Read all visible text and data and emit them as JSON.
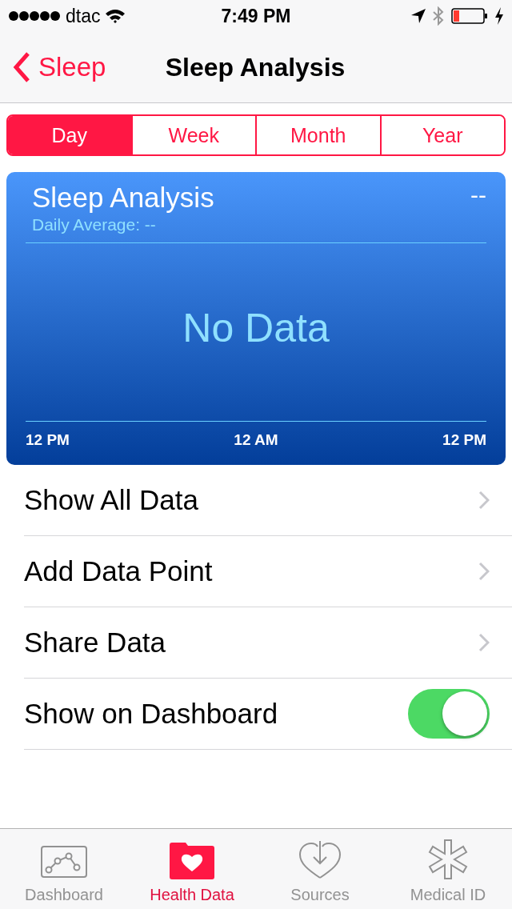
{
  "status_bar": {
    "carrier": "dtac",
    "time": "7:49 PM"
  },
  "nav": {
    "back": "Sleep",
    "title": "Sleep Analysis"
  },
  "segments": [
    {
      "label": "Day",
      "selected": true
    },
    {
      "label": "Week",
      "selected": false
    },
    {
      "label": "Month",
      "selected": false
    },
    {
      "label": "Year",
      "selected": false
    }
  ],
  "card": {
    "title": "Sleep Analysis",
    "value": "--",
    "subtitle": "Daily Average: --",
    "empty_text": "No Data",
    "axis_labels": [
      "12 PM",
      "12 AM",
      "12 PM"
    ]
  },
  "rows": [
    {
      "kind": "link",
      "label": "Show All Data"
    },
    {
      "kind": "link",
      "label": "Add Data Point"
    },
    {
      "kind": "link",
      "label": "Share Data"
    },
    {
      "kind": "toggle",
      "label": "Show on Dashboard",
      "on": true
    }
  ],
  "tab_bar": [
    {
      "kind": "dashboard",
      "label": "Dashboard",
      "selected": false
    },
    {
      "kind": "health",
      "label": "Health Data",
      "selected": true
    },
    {
      "kind": "sources",
      "label": "Sources",
      "selected": false
    },
    {
      "kind": "medical",
      "label": "Medical ID",
      "selected": false
    }
  ]
}
